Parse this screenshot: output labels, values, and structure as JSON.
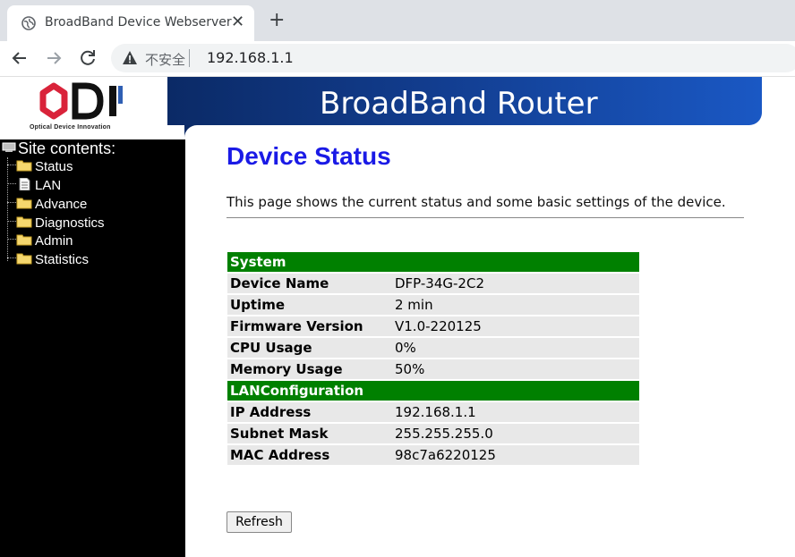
{
  "browser": {
    "tab_title": "BroadBand Device Webserver",
    "tab_close": "✕",
    "new_tab": "+",
    "security_label": "不安全",
    "url": "192.168.1.1"
  },
  "header": {
    "logo_text": "ODI",
    "logo_tagline": "Optical Device Innovation",
    "banner_title": "BroadBand Router"
  },
  "sidebar": {
    "heading": "Site contents:",
    "items": [
      {
        "label": "Status",
        "icon": "folder-icon"
      },
      {
        "label": "LAN",
        "icon": "document-icon"
      },
      {
        "label": "Advance",
        "icon": "folder-icon"
      },
      {
        "label": "Diagnostics",
        "icon": "folder-icon"
      },
      {
        "label": "Admin",
        "icon": "folder-icon"
      },
      {
        "label": "Statistics",
        "icon": "folder-icon"
      }
    ]
  },
  "main": {
    "title": "Device Status",
    "description": "This page shows the current status and some basic settings of the device.",
    "sections": [
      {
        "heading": "System",
        "rows": [
          {
            "key": "Device Name",
            "value": "DFP-34G-2C2"
          },
          {
            "key": "Uptime",
            "value": "2 min"
          },
          {
            "key": "Firmware Version",
            "value": "V1.0-220125"
          },
          {
            "key": "CPU Usage",
            "value": "0%"
          },
          {
            "key": "Memory Usage",
            "value": "50%"
          }
        ]
      },
      {
        "heading": "LANConfiguration",
        "rows": [
          {
            "key": "IP Address",
            "value": "192.168.1.1"
          },
          {
            "key": "Subnet Mask",
            "value": "255.255.255.0"
          },
          {
            "key": "MAC Address",
            "value": "98c7a6220125"
          }
        ]
      }
    ],
    "refresh_label": "Refresh"
  },
  "colors": {
    "section_header": "#008000",
    "row_bg": "#e8e8e8",
    "title": "#1a1ae6",
    "banner": "#123d8f",
    "logo_accent": "#d9233a"
  }
}
